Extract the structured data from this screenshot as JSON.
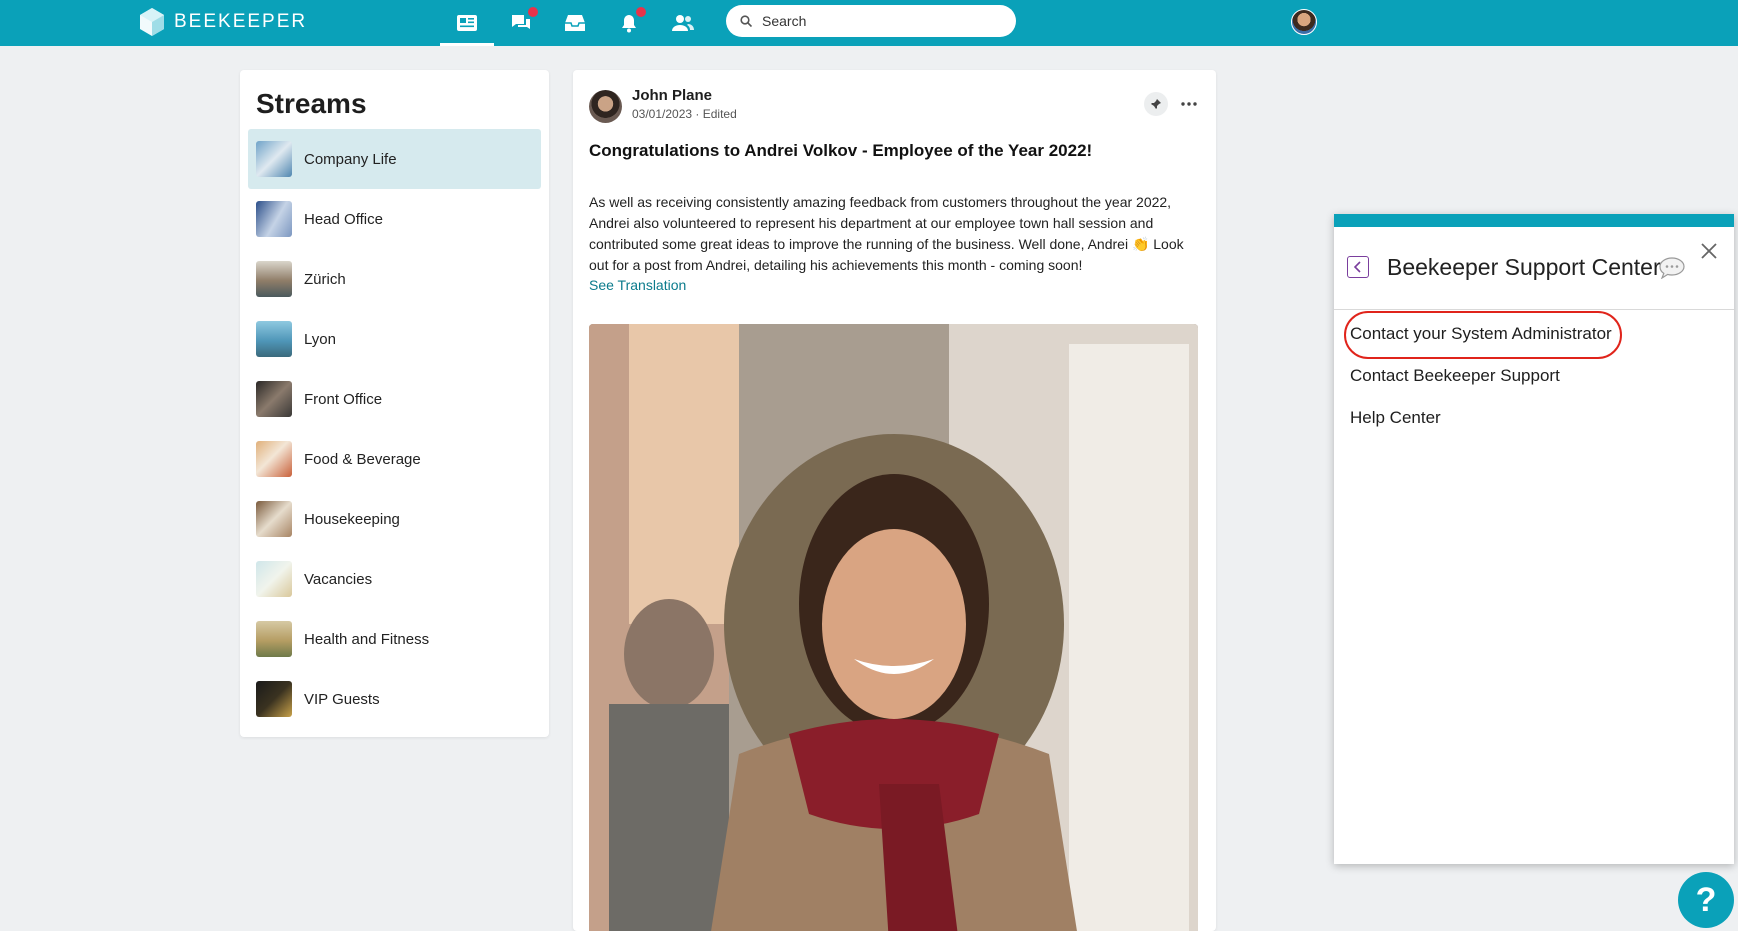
{
  "app": {
    "brand": "BEEKEEPER",
    "accent": "#0aa1b9"
  },
  "nav": {
    "icons": [
      "feed-icon",
      "chat-icon",
      "inbox-icon",
      "bell-icon",
      "people-icon"
    ],
    "search_placeholder": "Search"
  },
  "streams": {
    "title": "Streams",
    "items": [
      {
        "label": "Company Life",
        "active": true
      },
      {
        "label": "Head Office"
      },
      {
        "label": "Zürich"
      },
      {
        "label": "Lyon"
      },
      {
        "label": "Front Office"
      },
      {
        "label": "Food & Beverage"
      },
      {
        "label": "Housekeeping"
      },
      {
        "label": "Vacancies"
      },
      {
        "label": "Health and Fitness"
      },
      {
        "label": "VIP Guests"
      }
    ]
  },
  "post": {
    "author": "John Plane",
    "date": "03/01/2023",
    "edited": "Edited",
    "title": "Congratulations to Andrei Volkov - Employee of the Year 2022!",
    "body": "As well as receiving consistently amazing feedback from customers throughout the year 2022, Andrei also volunteered to represent his department at our employee town hall session and contributed some great ideas to improve the running of the business. Well done, Andrei 👏 Look out for a post from Andrei, detailing his achievements this month - coming soon!",
    "see_translation": "See Translation"
  },
  "support": {
    "title": "Beekeeper Support Center",
    "links": [
      "Contact your System Administrator",
      "Contact Beekeeper Support",
      "Help Center"
    ]
  },
  "help_fab": "?"
}
